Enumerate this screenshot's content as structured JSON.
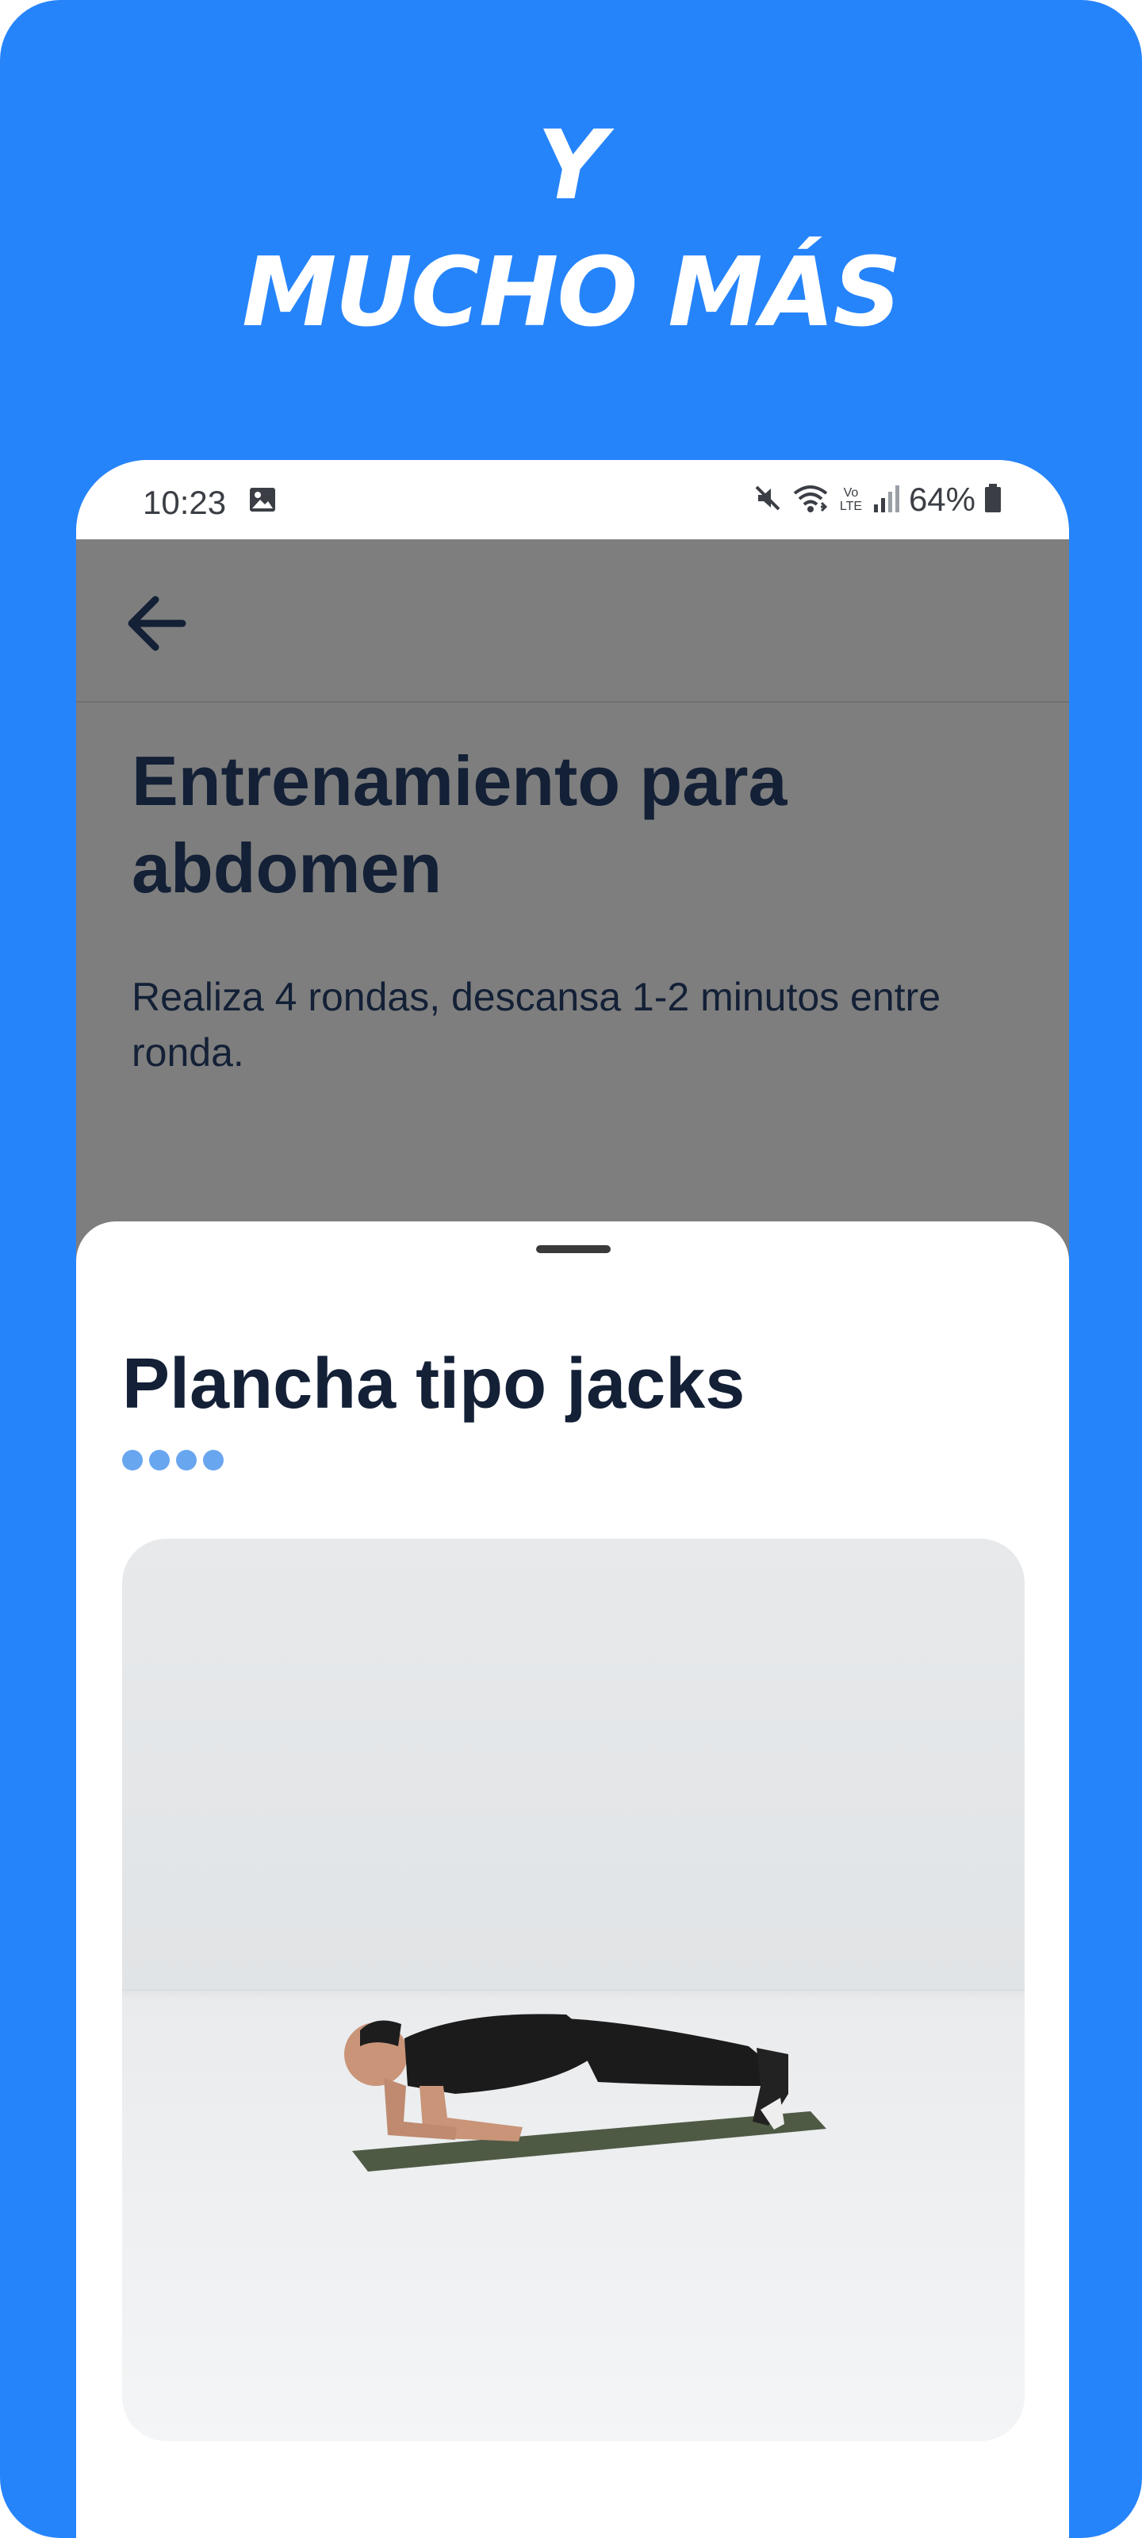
{
  "promo": {
    "line1": "Y",
    "line2": "MUCHO MÁS"
  },
  "status_bar": {
    "time": "10:23",
    "battery": "64%",
    "network_label": "Vo LTE"
  },
  "toolbar": {
    "back_icon": "arrow-left-icon"
  },
  "workout": {
    "title": "Entrenamiento para abdomen",
    "description": "Realiza 4 rondas, descansa 1-2 minutos entre ronda."
  },
  "exercise_sheet": {
    "title": "Plancha tipo jacks",
    "indicator_dots": 4,
    "media_description_icon": "person-plank-illustration"
  },
  "colors": {
    "promo_background": "#2684fb",
    "text_dark": "#132036",
    "dim_overlay": "#7e7e7e",
    "dot_accent": "#69a6f0"
  }
}
